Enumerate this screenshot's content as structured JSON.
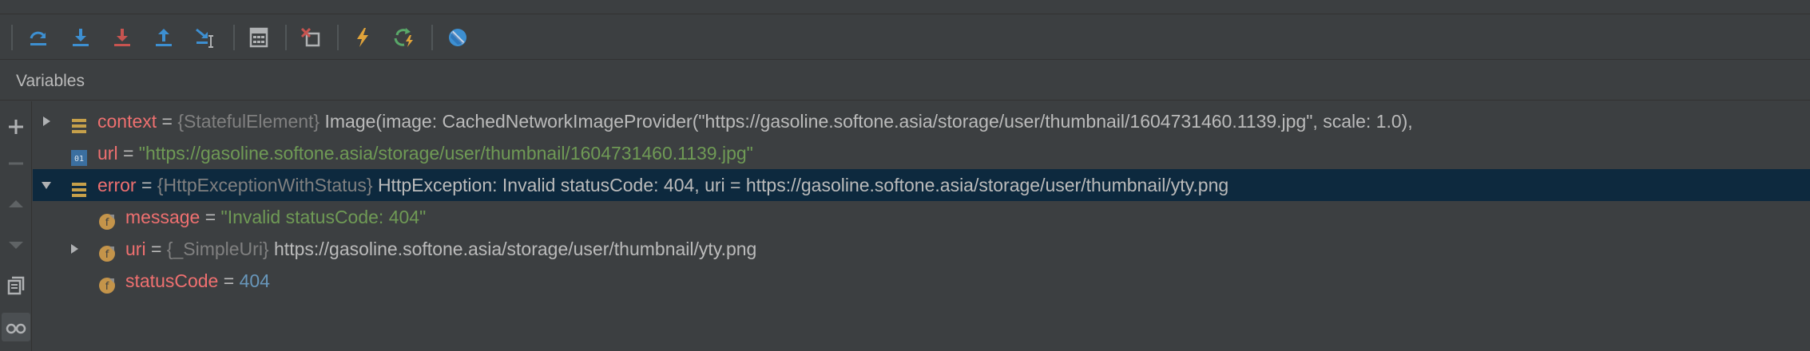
{
  "toolbar": {
    "buttons": [
      {
        "icon": "step-over-icon",
        "color": "#3d8fd1"
      },
      {
        "icon": "step-into-icon",
        "color": "#3d8fd1"
      },
      {
        "icon": "force-step-into-icon",
        "color": "#c75450"
      },
      {
        "icon": "step-out-icon",
        "color": "#3d8fd1"
      },
      {
        "icon": "run-to-cursor-icon",
        "color": "#3d8fd1"
      },
      {
        "icon": "evaluate-expression-icon",
        "color": "#afb1b3"
      },
      {
        "icon": "drop-frame-icon",
        "color": "#c75450"
      },
      {
        "icon": "hot-reload-icon",
        "color": "#e0a33a"
      },
      {
        "icon": "hot-restart-icon",
        "color": "#59a869"
      },
      {
        "icon": "dart-devtools-icon",
        "color": "#3d8fd1"
      }
    ]
  },
  "panel": {
    "title": "Variables"
  },
  "sidebar": {
    "icons": [
      "add-watch-icon",
      "remove-icon",
      "move-up-icon",
      "move-down-icon",
      "copy-icon",
      "glasses-icon"
    ]
  },
  "variables": [
    {
      "name": "context",
      "eq": " = ",
      "type": "{StatefulElement} ",
      "value": "Image(image: CachedNetworkImageProvider(\"https://gasoline.softone.asia/storage/user/thumbnail/1604731460.1139.jpg\", scale: 1.0),",
      "icon": "object-icon",
      "expandable": true,
      "expanded": false
    },
    {
      "name": "url",
      "eq": " = ",
      "type": "",
      "value": "\"https://gasoline.softone.asia/storage/user/thumbnail/1604731460.1139.jpg\"",
      "icon": "primitive-icon",
      "expandable": false
    },
    {
      "name": "error",
      "eq": " = ",
      "type": "{HttpExceptionWithStatus} ",
      "value": "HttpException: Invalid statusCode: 404, uri = https://gasoline.softone.asia/storage/user/thumbnail/yty.png",
      "icon": "object-icon",
      "expandable": true,
      "expanded": true,
      "selected": true
    },
    {
      "name": "message",
      "eq": " = ",
      "type": "",
      "value": "\"Invalid statusCode: 404\"",
      "icon": "field-icon",
      "expandable": false
    },
    {
      "name": "uri",
      "eq": " = ",
      "type": "{_SimpleUri} ",
      "value": "https://gasoline.softone.asia/storage/user/thumbnail/yty.png",
      "icon": "field-icon",
      "expandable": true,
      "expanded": false
    },
    {
      "name": "statusCode",
      "eq": " = ",
      "type": "",
      "value": "404",
      "icon": "field-icon",
      "expandable": false
    }
  ]
}
